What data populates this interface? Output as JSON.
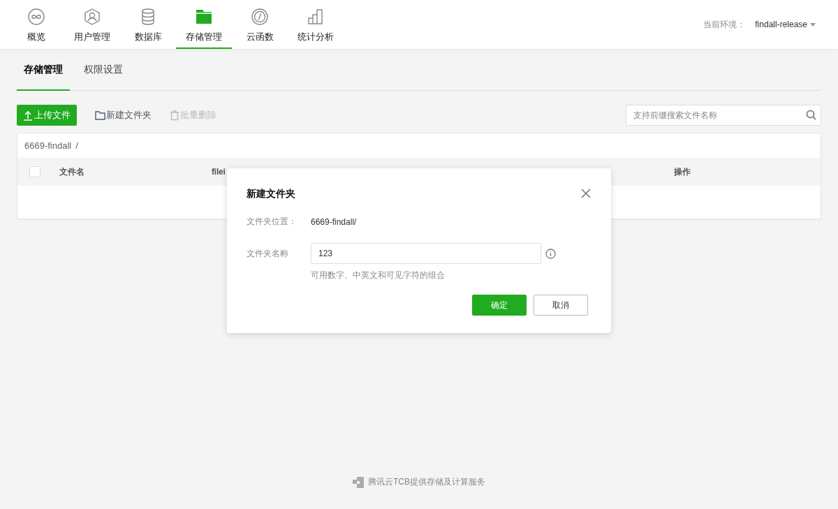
{
  "top_nav": {
    "items": [
      {
        "label": "概览",
        "selected": false
      },
      {
        "label": "用户管理",
        "selected": false
      },
      {
        "label": "数据库",
        "selected": false
      },
      {
        "label": "存储管理",
        "selected": true
      },
      {
        "label": "云函数",
        "selected": false
      },
      {
        "label": "统计分析",
        "selected": false
      }
    ],
    "environment": {
      "label": "当前环境：",
      "value": "findall-release"
    }
  },
  "sub_tabs": [
    {
      "label": "存储管理",
      "selected": true
    },
    {
      "label": "权限设置",
      "selected": false
    }
  ],
  "toolbar": {
    "buttons": [
      {
        "label": "上传文件",
        "kind": "primary",
        "disabled": false
      },
      {
        "label": "新建文件夹",
        "kind": "link",
        "disabled": false
      },
      {
        "label": "批量删除",
        "kind": "link",
        "disabled": true
      }
    ],
    "search": {
      "placeholder": "支持前缀搜索文件名称"
    }
  },
  "file_table": {
    "breadcrumb": "6669-findall",
    "separator": "/",
    "select_all": {
      "checked": false
    },
    "columns": [
      "文件名",
      "filei",
      "操作"
    ]
  },
  "dialog": {
    "title": "新建文件夹",
    "location_label": "文件夹位置：",
    "location_value": "6669-findall/",
    "name_label": "文件夹名称",
    "name_value": "123",
    "hint": "可用数字、中英文和可见字符的组合",
    "buttons": [
      {
        "label": "确定",
        "kind": "primary"
      },
      {
        "label": "取消",
        "kind": "default"
      }
    ]
  },
  "footer": "腾讯云TCB提供存储及计算服务"
}
